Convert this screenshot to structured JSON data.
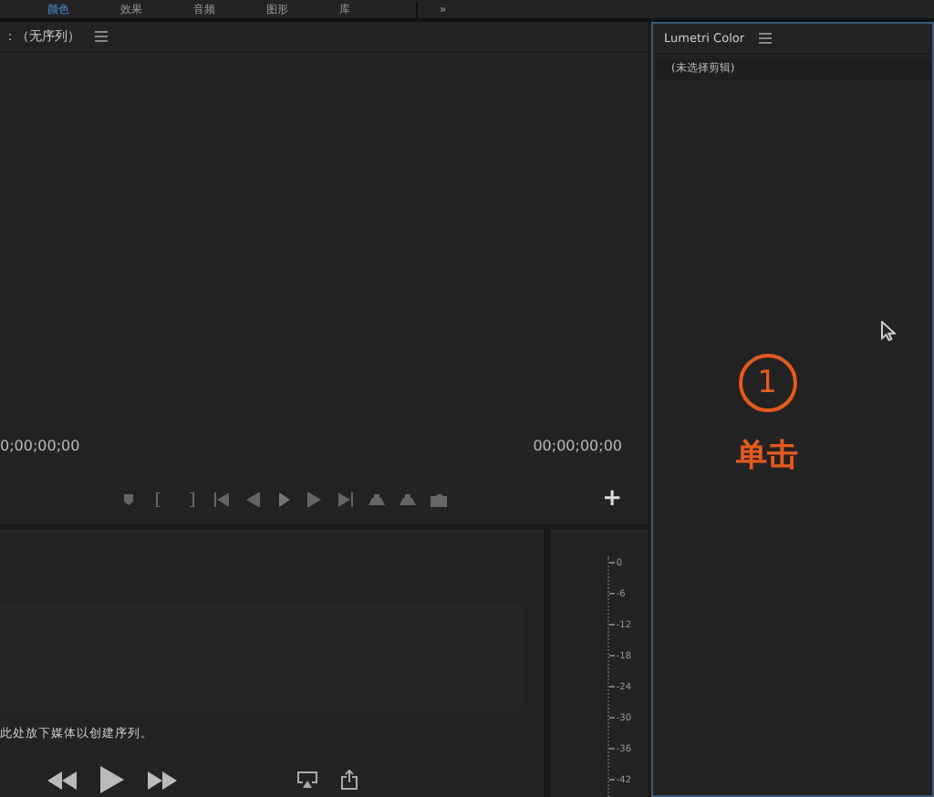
{
  "workspace_tabs": [
    {
      "label": "颜色",
      "selected": true
    },
    {
      "label": "效果",
      "selected": false
    },
    {
      "label": "音频",
      "selected": false
    },
    {
      "label": "图形",
      "selected": false
    },
    {
      "label": "库",
      "selected": false
    }
  ],
  "workspace_more": "»",
  "program_monitor": {
    "title": "：（无序列）",
    "timecode_left": "0;00;00;00",
    "timecode_right": "00;00;00;00",
    "add_button": "+"
  },
  "lumetri": {
    "title": "Lumetri Color",
    "clip_status": "(未选择剪辑)",
    "step_number": "1",
    "step_label": "单击"
  },
  "project_panel": {
    "hint": "此处放下媒体以创建序列。"
  },
  "audio_meter": {
    "ticks": [
      "0",
      "-6",
      "-12",
      "-18",
      "-24",
      "-30",
      "-36",
      "-42"
    ]
  }
}
